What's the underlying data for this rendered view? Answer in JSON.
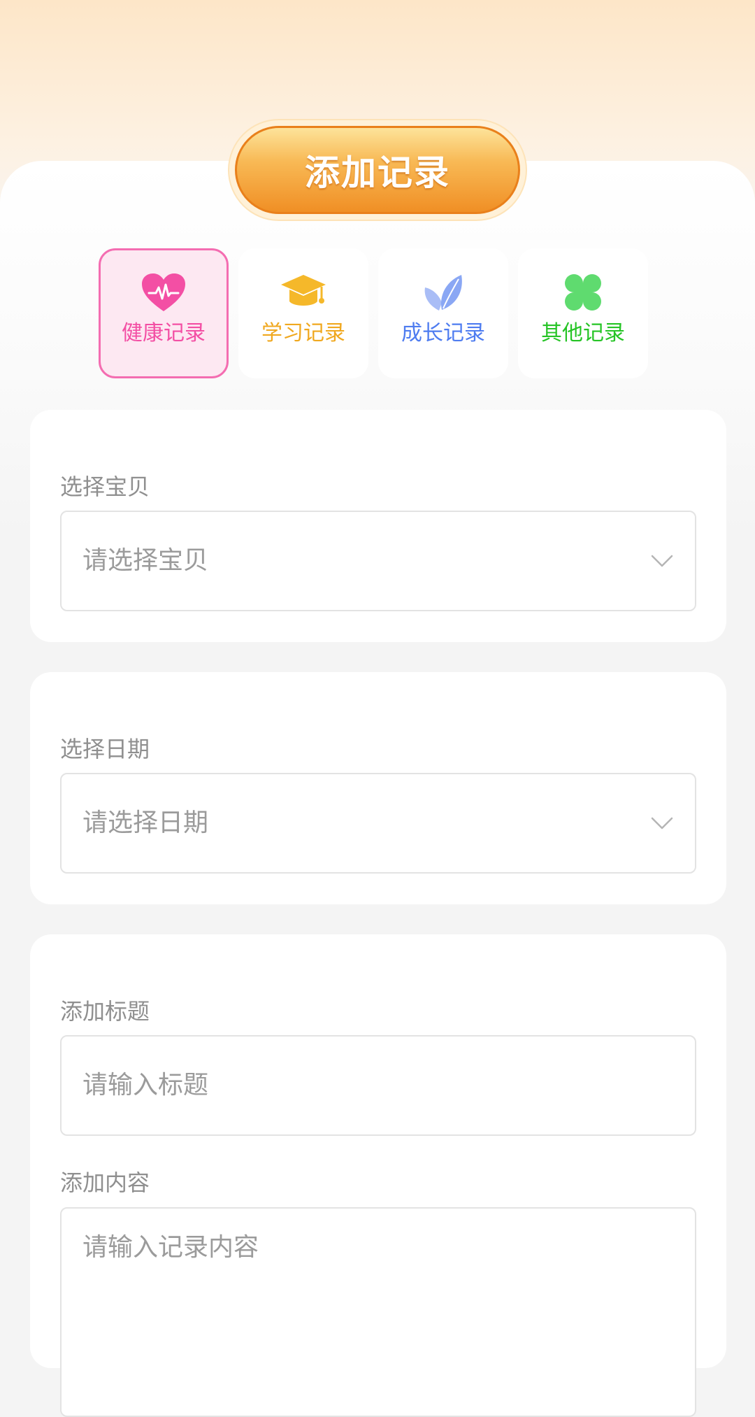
{
  "header": {
    "title": "添加记录"
  },
  "categories": [
    {
      "label": "健康记录",
      "icon": "heart-pulse-icon",
      "color": "#f34fa4",
      "active": true
    },
    {
      "label": "学习记录",
      "icon": "graduation-cap-icon",
      "color": "#f0a81f",
      "active": false
    },
    {
      "label": "成长记录",
      "icon": "leaf-icon",
      "color": "#4e7cf0",
      "active": false
    },
    {
      "label": "其他记录",
      "icon": "clover-icon",
      "color": "#26c426",
      "active": false
    }
  ],
  "form": {
    "baby": {
      "label": "选择宝贝",
      "placeholder": "请选择宝贝"
    },
    "date": {
      "label": "选择日期",
      "placeholder": "请选择日期"
    },
    "title": {
      "label": "添加标题",
      "placeholder": "请输入标题"
    },
    "content": {
      "label": "添加内容",
      "placeholder": "请输入记录内容"
    }
  },
  "colors": {
    "accent_orange": "#f08f25",
    "active_pink": "#f46db1",
    "background": "#f4f4f4"
  }
}
